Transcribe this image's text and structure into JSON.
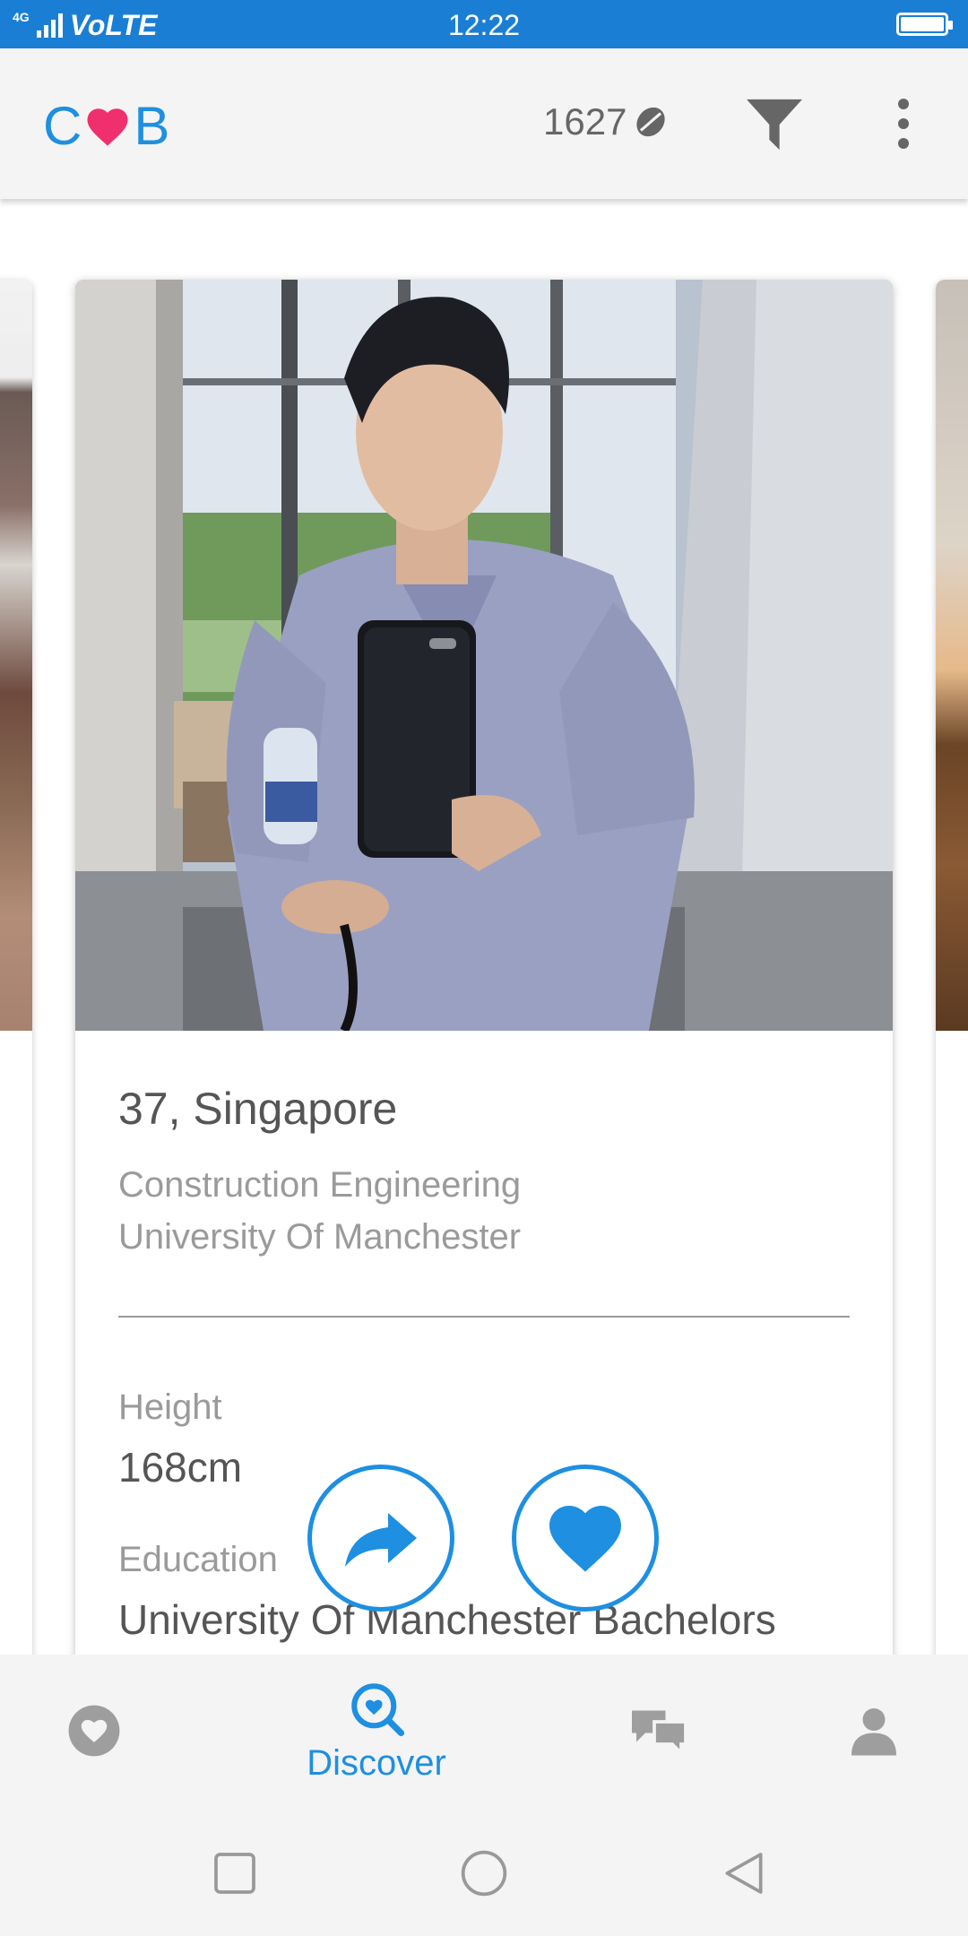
{
  "status_bar": {
    "network": "4G",
    "carrier_label": "VoLTE",
    "time": "12:22",
    "battery_level": 1.0
  },
  "header": {
    "logo_left": "C",
    "logo_right": "B",
    "logo_heart_icon": "heart-icon",
    "credits": "1627",
    "credits_icon": "coffee-bean-icon",
    "filter_icon": "filter-icon",
    "menu_icon": "more-vert-icon"
  },
  "profile_card": {
    "age_location": "37, Singapore",
    "occupation": "Construction Engineering",
    "school": "University Of Manchester",
    "details": {
      "height_label": "Height",
      "height_value": "168cm",
      "education_label": "Education",
      "education_value": "University Of Manchester Bachelors"
    }
  },
  "actions": {
    "share_icon": "share-arrow-icon",
    "like_icon": "heart-icon"
  },
  "bottom_nav": {
    "items": [
      {
        "icon": "heart-circle-icon",
        "label": "",
        "active": false
      },
      {
        "icon": "discover-search-icon",
        "label": "Discover",
        "active": true
      },
      {
        "icon": "chat-bubbles-icon",
        "label": "",
        "active": false
      },
      {
        "icon": "person-icon",
        "label": "",
        "active": false
      }
    ]
  },
  "colors": {
    "accent": "#1e8fe1",
    "status_bar": "#1a7fd4",
    "logo_heart": "#f0306e",
    "inactive_icon": "#9e9e9e"
  }
}
